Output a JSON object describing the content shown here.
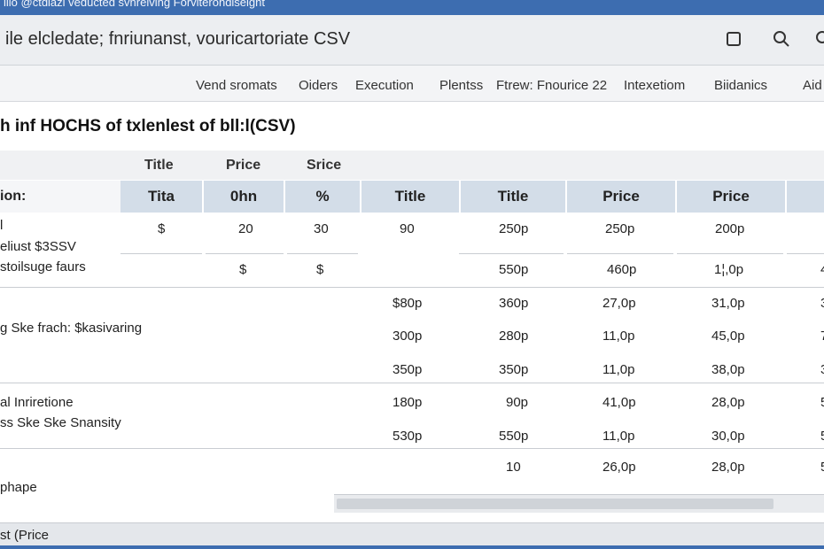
{
  "titlebar": {
    "text": "ilio @ctdiazi veducted svhrelving Forviterondiseight"
  },
  "header": {
    "title": "ile elcledate; fnriunanst, vouricartoriate CSV"
  },
  "icons": {
    "square": "square-icon",
    "search": "search-icon",
    "partial": "search-icon"
  },
  "menu": [
    "Vend sromats",
    "Oiders",
    "Execution",
    "Plentss",
    "Ftrew: Fnourice 22",
    "Intexetiom",
    "Biidanics",
    "Aid"
  ],
  "page_title": "h inf HOCHS of txlenlest of bll:l(CSV)",
  "table": {
    "super_headers": [
      "Title",
      "Price",
      "Srice"
    ],
    "row_label_header": "ion:",
    "col_headers": [
      "Tita",
      "0hn",
      "%",
      "Title",
      "Title",
      "Price",
      "Price",
      ""
    ],
    "row_labels": [
      "l",
      "eliust $3SSV",
      "stoilsuge faurs",
      "g Ske frach: $kasivaring",
      "al Inriretione",
      "ss Ske Ske Snansity",
      "phape"
    ],
    "rows": [
      [
        "$",
        "20",
        "30",
        "90",
        "250p",
        "250p",
        "200p",
        ""
      ],
      [
        "",
        "$",
        "$",
        "",
        "550p",
        "460p",
        "1¦,0p",
        "4"
      ],
      [
        "",
        "",
        "",
        "$80p",
        "360p",
        "27,0p",
        "31,0p",
        "3"
      ],
      [
        "",
        "",
        "",
        "300p",
        "280p",
        "11,0p",
        "45,0p",
        "7"
      ],
      [
        "",
        "",
        "",
        "350p",
        "350p",
        "11,0p",
        "38,0p",
        "3"
      ],
      [
        "",
        "",
        "",
        "180p",
        "90p",
        "41,0p",
        "28,0p",
        "5"
      ],
      [
        "",
        "",
        "",
        "530p",
        "550p",
        "11,0p",
        "30,0p",
        "5"
      ],
      [
        "",
        "",
        "",
        "",
        "10",
        "26,0p",
        "28,0p",
        "5"
      ]
    ]
  },
  "footer": {
    "text": "st (Price"
  },
  "colors": {
    "titlebar": "#3d6db0",
    "header_bg": "#eceef1",
    "col_header_bg": "#d3dde8"
  }
}
